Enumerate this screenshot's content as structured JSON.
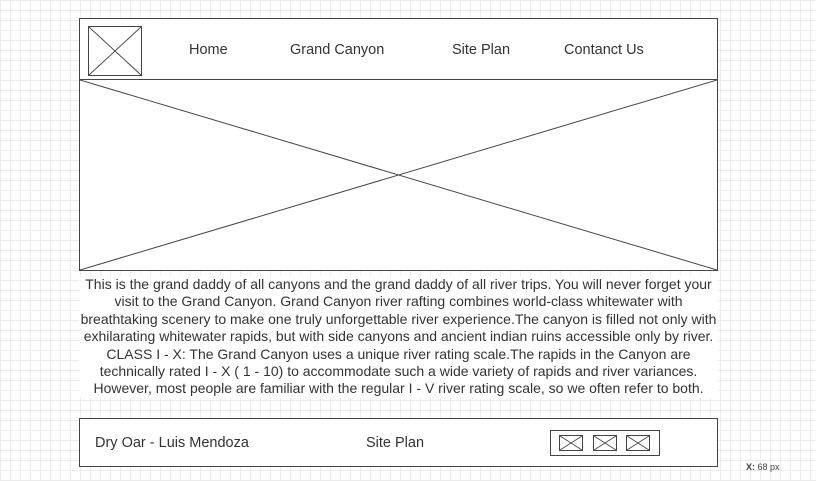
{
  "header": {
    "nav": {
      "home": "Home",
      "grand_canyon": "Grand Canyon",
      "site_plan": "Site Plan",
      "contact": "Contanct Us"
    }
  },
  "main": {
    "text": "This is the grand daddy of all canyons and the grand daddy of all river trips. You will never forget your visit to the Grand Canyon. Grand Canyon river rafting combines world-class whitewater with breathtaking scenery to make one truly unforgettable river experience.The canyon is filled not only with exhilarating whitewater rapids, but with side canyons and ancient indian ruins accessible only by river. CLASS I - X: The Grand Canyon uses a unique river rating scale.The rapids in the Canyon are technically rated I - X ( 1 - 10) to accommodate such a wide variety of rapids and river variances. However, most people are familiar with the regular I - V river rating scale, so we often refer to both."
  },
  "footer": {
    "credit": "Dry Oar - Luis Mendoza",
    "site_plan": "Site Plan",
    "social_icons": [
      "image-placeholder-icon",
      "image-placeholder-icon",
      "image-placeholder-icon"
    ]
  },
  "status": {
    "coord_label": "X:",
    "coord_value": "68 px"
  },
  "colors": {
    "stroke": "#444444",
    "text": "#333333",
    "grid": "#ececec"
  }
}
